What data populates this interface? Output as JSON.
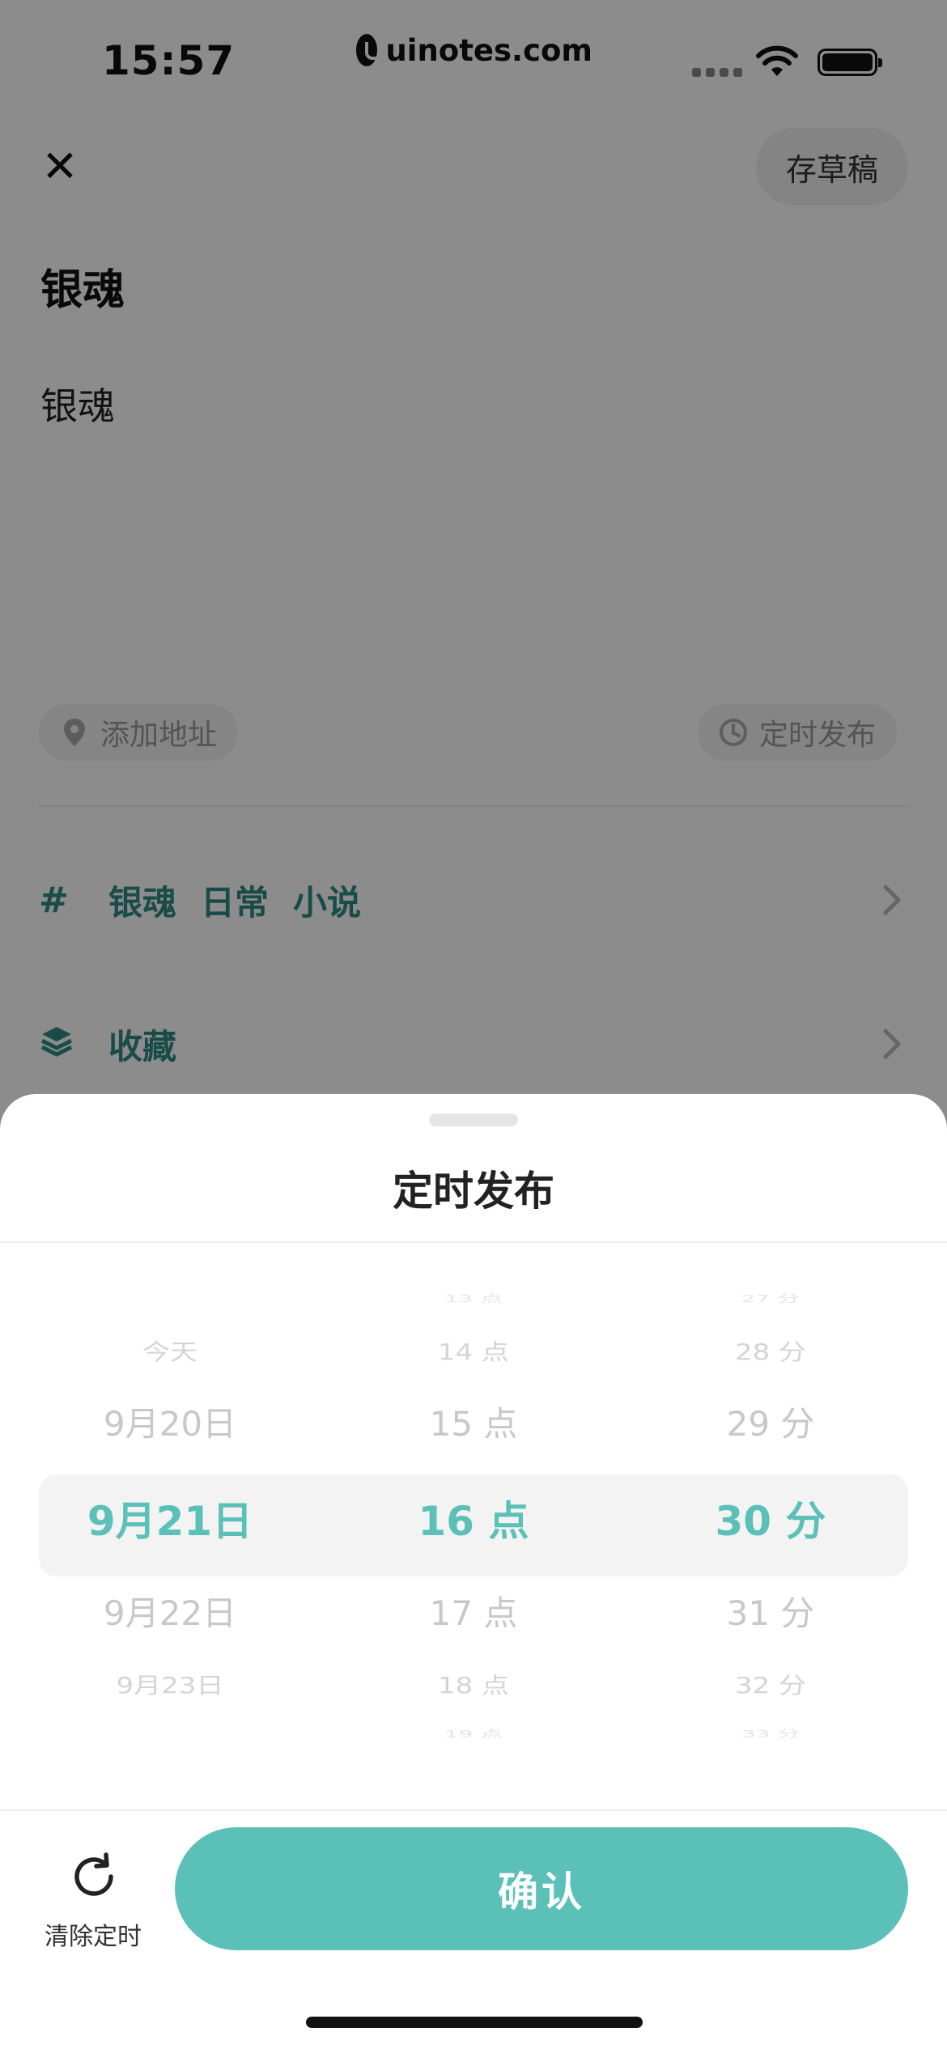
{
  "status_bar": {
    "time": "15:57",
    "watermark": "uinotes.com"
  },
  "header": {
    "draft_label": "存草稿"
  },
  "post": {
    "title": "银魂",
    "body": "银魂"
  },
  "chips": {
    "location": "添加地址",
    "schedule": "定时发布"
  },
  "tags": {
    "icon": "#",
    "items": [
      "银魂",
      "日常",
      "小说"
    ]
  },
  "collection": {
    "label": "收藏"
  },
  "sheet": {
    "title": "定时发布",
    "date_column": [
      "",
      "今天",
      "9月20日",
      "9月21日",
      "9月22日",
      "9月23日",
      ""
    ],
    "hour_column": [
      "13 点",
      "14 点",
      "15 点",
      "16 点",
      "17 点",
      "18 点",
      "19 点"
    ],
    "minute_column": [
      "27 分",
      "28 分",
      "29 分",
      "30 分",
      "31 分",
      "32 分",
      "33 分"
    ],
    "selected": {
      "date": "9月21日",
      "hour": "16 点",
      "minute": "30 分"
    },
    "clear_label": "清除定时",
    "confirm_label": "确认"
  },
  "colors": {
    "accent": "#5bc0b8",
    "tag_text": "#2e8a83",
    "overlay": "rgba(0,0,0,0.45)"
  }
}
